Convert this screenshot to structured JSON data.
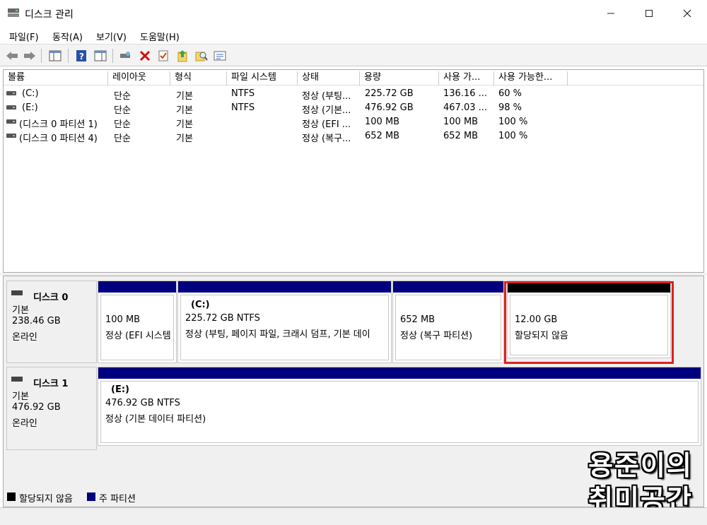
{
  "window": {
    "title": "디스크 관리"
  },
  "menu": [
    "파일(F)",
    "동작(A)",
    "보기(V)",
    "도움말(H)"
  ],
  "columns": [
    "볼륨",
    "레이아웃",
    "형식",
    "파일 시스템",
    "상태",
    "용량",
    "사용 가...",
    "사용 가능한..."
  ],
  "volumes": [
    {
      "name": "(C:)",
      "layout": "단순",
      "type": "기본",
      "fs": "NTFS",
      "status": "정상 (부팅...",
      "capacity": "225.72 GB",
      "free": "136.16 ...",
      "pct": "60 %"
    },
    {
      "name": "(E:)",
      "layout": "단순",
      "type": "기본",
      "fs": "NTFS",
      "status": "정상 (기본...",
      "capacity": "476.92 GB",
      "free": "467.03 ...",
      "pct": "98 %"
    },
    {
      "name": "(디스크 0 파티션 1)",
      "layout": "단순",
      "type": "기본",
      "fs": "",
      "status": "정상 (EFI ...",
      "capacity": "100 MB",
      "free": "100 MB",
      "pct": "100 %"
    },
    {
      "name": "(디스크 0 파티션 4)",
      "layout": "단순",
      "type": "기본",
      "fs": "",
      "status": "정상 (복구...",
      "capacity": "652 MB",
      "free": "652 MB",
      "pct": "100 %"
    }
  ],
  "disks": [
    {
      "name": "디스크 0",
      "kind": "기본",
      "size": "238.46 GB",
      "state": "온라인",
      "partitions": [
        {
          "title": "",
          "size": "100 MB",
          "status": "정상 (EFI 시스템"
        },
        {
          "title": "(C:)",
          "size": "225.72 GB NTFS",
          "status": "정상 (부팅, 페이지 파일, 크래시 덤프, 기본 데이"
        },
        {
          "title": "",
          "size": "652 MB",
          "status": "정상 (복구 파티션)"
        },
        {
          "title": "",
          "size": "12.00 GB",
          "status": "할당되지 않음"
        }
      ]
    },
    {
      "name": "디스크 1",
      "kind": "기본",
      "size": "476.92 GB",
      "state": "온라인",
      "partitions": [
        {
          "title": "(E:)",
          "size": "476.92 GB NTFS",
          "status": "정상 (기본 데이터 파티션)"
        }
      ]
    }
  ],
  "legend": [
    {
      "label": "할당되지 않음",
      "color": "#000000"
    },
    {
      "label": "주 파티션",
      "color": "#00007f"
    }
  ],
  "watermark": {
    "line1": "용준이의",
    "line2": "취미공간"
  },
  "colors": {
    "primary_partition": "#00007f",
    "unallocated": "#000000",
    "highlight": "#e02020"
  }
}
